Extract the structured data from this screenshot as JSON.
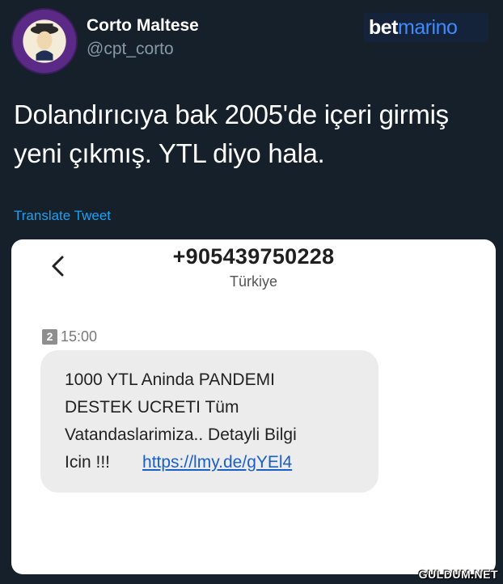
{
  "tweet": {
    "author": {
      "display_name": "Corto Maltese",
      "handle": "@cpt_corto",
      "avatar_icon": "avatar-badge-icon"
    },
    "brand": {
      "part1": "bet",
      "part2": "marino",
      "accent_color": "#3d8bff"
    },
    "text_line1": "Dolandırıcıya bak 2005'de içeri girmiş",
    "text_line2": "yeni çıkmış. YTL diyo hala.",
    "translate_label": "Translate Tweet",
    "link_color": "#1da1f2"
  },
  "sms": {
    "back_icon": "chevron-left-icon",
    "phone_number": "+905439750228",
    "country": "Türkiye",
    "sim_label": "2",
    "time": "15:00",
    "message_lines": [
      "1000  YTL Aninda PANDEMI",
      "DESTEK UCRETI Tüm",
      "Vatandaslarimiza.. Detayli Bilgi",
      "Icin !!!"
    ],
    "message_link": "https://lmy.de/gYEl4"
  },
  "watermark": "GULDUM.NET"
}
